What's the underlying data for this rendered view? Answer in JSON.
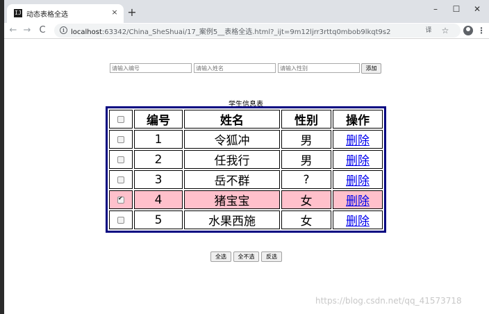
{
  "browser": {
    "tab_favicon": "IJ",
    "tab_title": "动态表格全选",
    "tab_close": "×",
    "new_tab": "+",
    "win_min": "–",
    "win_max": "☐",
    "win_close": "✕",
    "nav_back": "←",
    "nav_forward": "→",
    "nav_reload": "C",
    "info_icon": "i",
    "url_host": "localhost",
    "url_rest": ":63342/China_SheShuai/17_案例5__表格全选.html?_ijt=9m12ljrr3rttq0mbob9lkqt9s2",
    "translate_icon": "译",
    "star_icon": "☆",
    "menu_icon": "⋮"
  },
  "form": {
    "id_placeholder": "请输入编号",
    "name_placeholder": "请输入姓名",
    "gender_placeholder": "请输入性别",
    "add_label": "添加"
  },
  "table": {
    "caption": "学生信息表",
    "headers": {
      "id": "编号",
      "name": "姓名",
      "gender": "性别",
      "action": "操作"
    },
    "rows": [
      {
        "id": "1",
        "name": "令狐冲",
        "gender": "男",
        "action": "删除",
        "checked": false
      },
      {
        "id": "2",
        "name": "任我行",
        "gender": "男",
        "action": "删除",
        "checked": false
      },
      {
        "id": "3",
        "name": "岳不群",
        "gender": "?",
        "action": "删除",
        "checked": false
      },
      {
        "id": "4",
        "name": "猪宝宝",
        "gender": "女",
        "action": "删除",
        "checked": true
      },
      {
        "id": "5",
        "name": "水果西施",
        "gender": "女",
        "action": "删除",
        "checked": false
      }
    ],
    "highlight_color": "#ffc0cb",
    "border_color": "#000080"
  },
  "controls": {
    "select_all": "全选",
    "select_none": "全不选",
    "invert": "反选"
  },
  "watermark": "https://blog.csdn.net/qq_41573718"
}
